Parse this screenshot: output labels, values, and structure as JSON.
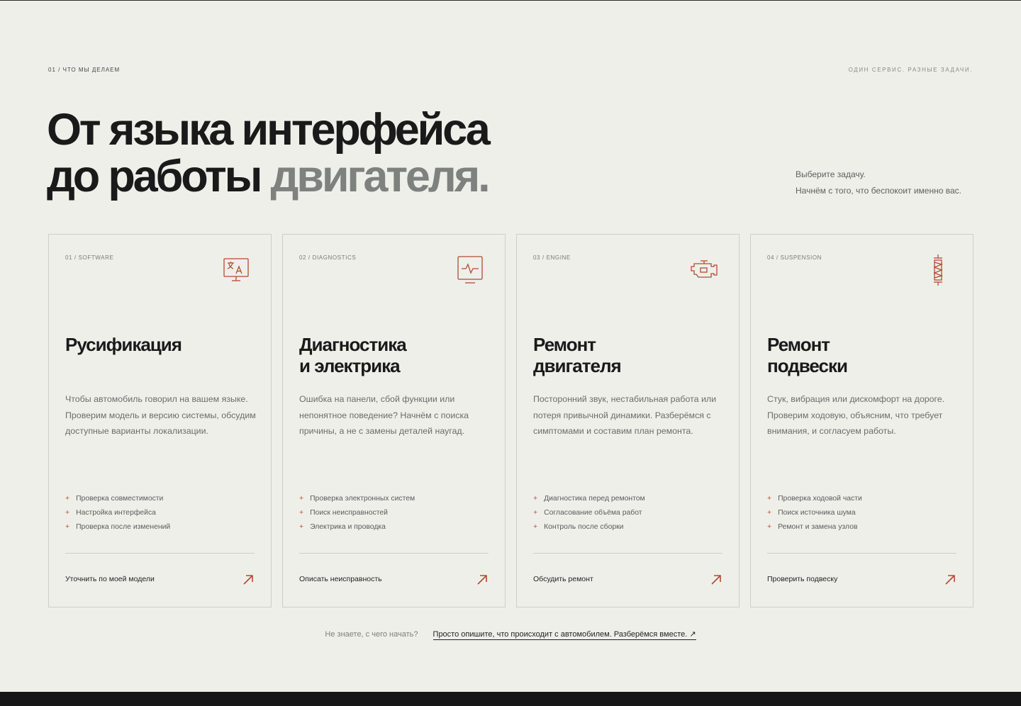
{
  "section": {
    "eyebrow": "01 / ЧТО МЫ ДЕЛАЕМ",
    "tagline": "ОДИН СЕРВИС. РАЗНЫЕ ЗАДАЧИ."
  },
  "headline": {
    "line1": "От языка интерфейса",
    "line2_main": "до работы ",
    "line2_accent": "двигателя."
  },
  "intro": {
    "line1": "Выберите задачу.",
    "line2": "Начнём с того, что беспокоит именно вас."
  },
  "colors": {
    "accent": "#b34a2e",
    "background": "#efefea",
    "text": "#1a1a1a",
    "muted": "#7e817e"
  },
  "cards": [
    {
      "tag": "01 / SOFTWARE",
      "icon": "translate-monitor-icon",
      "title_line1": "Русификация",
      "title_line2": "",
      "description": "Чтобы автомобиль говорил на вашем языке. Проверим модель и версию системы, обсудим доступные варианты локализации.",
      "items": [
        "Проверка совместимости",
        "Настройка интерфейса",
        "Проверка после изменений"
      ],
      "cta": "Уточнить по моей модели"
    },
    {
      "tag": "02 / DIAGNOSTICS",
      "icon": "diagnostics-monitor-icon",
      "title_line1": "Диагностика",
      "title_line2": "и электрика",
      "description": "Ошибка на панели, сбой функции или непонятное поведение? Начнём с поиска причины, а не с замены деталей наугад.",
      "items": [
        "Проверка электронных систем",
        "Поиск неисправностей",
        "Электрика и проводка"
      ],
      "cta": "Описать неисправность"
    },
    {
      "tag": "03 / ENGINE",
      "icon": "engine-icon",
      "title_line1": "Ремонт",
      "title_line2": "двигателя",
      "description": "Посторонний звук, нестабильная работа или потеря привычной динамики. Разберёмся с симптомами и составим план ремонта.",
      "items": [
        "Диагностика перед ремонтом",
        "Согласование объёма работ",
        "Контроль после сборки"
      ],
      "cta": "Обсудить ремонт"
    },
    {
      "tag": "04 / SUSPENSION",
      "icon": "suspension-spring-icon",
      "title_line1": "Ремонт",
      "title_line2": "подвески",
      "description": "Стук, вибрация или дискомфорт на дороге. Проверим ходовую, объясним, что требует внимания, и согласуем работы.",
      "items": [
        "Проверка ходовой части",
        "Поиск источника шума",
        "Ремонт и замена узлов"
      ],
      "cta": "Проверить подвеску"
    }
  ],
  "bottom": {
    "question": "Не знаете, с чего начать?",
    "link": "Просто опишите, что происходит с автомобилем. Разберёмся вместе. ↗"
  }
}
